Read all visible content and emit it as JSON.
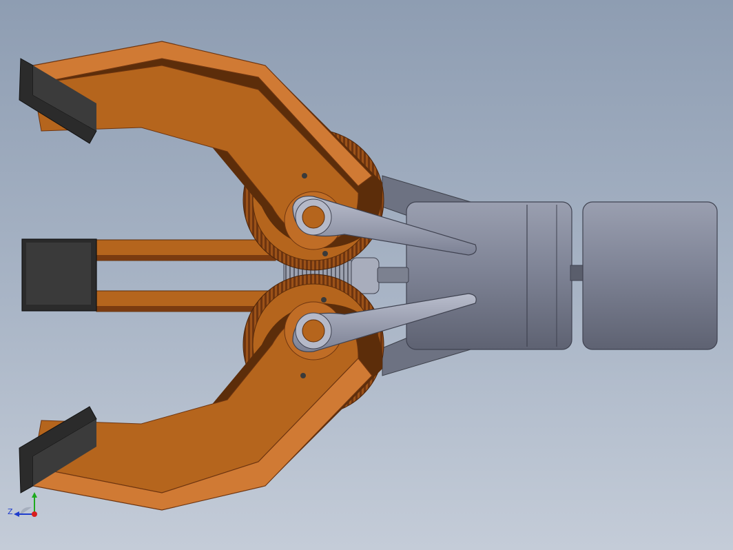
{
  "viewport": {
    "background_top": "#8e9db2",
    "background_bottom": "#c4ccd8"
  },
  "model": {
    "description_icon": "robotic-gripper-assembly",
    "colors": {
      "jaw_body": "#b5651d",
      "jaw_shadow": "#5c2d0a",
      "jaw_edge": "#d9813a",
      "fingertip_pad": "#2b2b2b",
      "linkage_steel": "#8a8fa3",
      "motor_housing": "#7f8496",
      "motor_dark": "#5a5e6c"
    }
  },
  "triad": {
    "z_label": "Z",
    "x_color": "#d81e1e",
    "y_color": "#1eaa1e",
    "z_color": "#1e3ccc"
  }
}
